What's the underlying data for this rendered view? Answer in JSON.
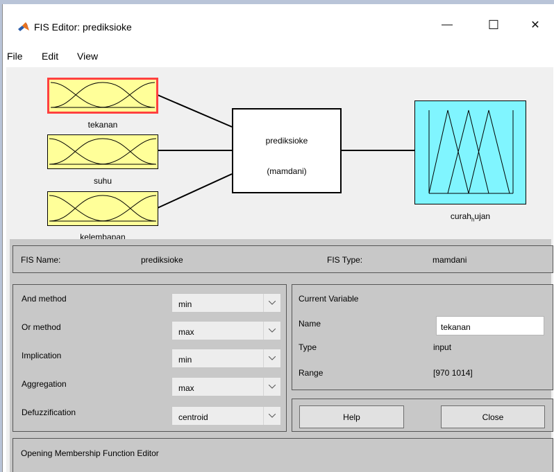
{
  "window": {
    "title": "FIS Editor: prediksioke",
    "controls": [
      "minimize-icon",
      "maximize-icon",
      "close-icon"
    ],
    "minimize_glyph": "—",
    "maximize_glyph": "☐",
    "close_glyph": "✕"
  },
  "menu": {
    "items": [
      "File",
      "Edit",
      "View"
    ]
  },
  "diagram": {
    "inputs": [
      {
        "name": "tekanan",
        "selected": true
      },
      {
        "name": "suhu",
        "selected": false
      },
      {
        "name": "kelembapan",
        "selected": false
      }
    ],
    "system": {
      "name": "prediksioke",
      "type": "(mamdani)"
    },
    "output": {
      "name_main": "curah",
      "name_sub": "h",
      "name_tail": "ujan"
    }
  },
  "fis_info": {
    "name_label": "FIS Name:",
    "name_value": "prediksioke",
    "type_label": "FIS Type:",
    "type_value": "mamdani"
  },
  "methods": [
    {
      "label": "And method",
      "value": "min"
    },
    {
      "label": "Or method",
      "value": "max"
    },
    {
      "label": "Implication",
      "value": "min"
    },
    {
      "label": "Aggregation",
      "value": "max"
    },
    {
      "label": "Defuzzification",
      "value": "centroid"
    }
  ],
  "current_variable": {
    "header": "Current Variable",
    "name_label": "Name",
    "name_value": "tekanan",
    "type_label": "Type",
    "type_value": "input",
    "range_label": "Range",
    "range_value": "[970 1014]"
  },
  "buttons": {
    "help": "Help",
    "close": "Close"
  },
  "status": "Opening Membership Function Editor",
  "colors": {
    "input_box": "#ffff99",
    "output_box": "#80f5ff",
    "selection": "#ff4040",
    "panel": "#c8c8c8"
  }
}
